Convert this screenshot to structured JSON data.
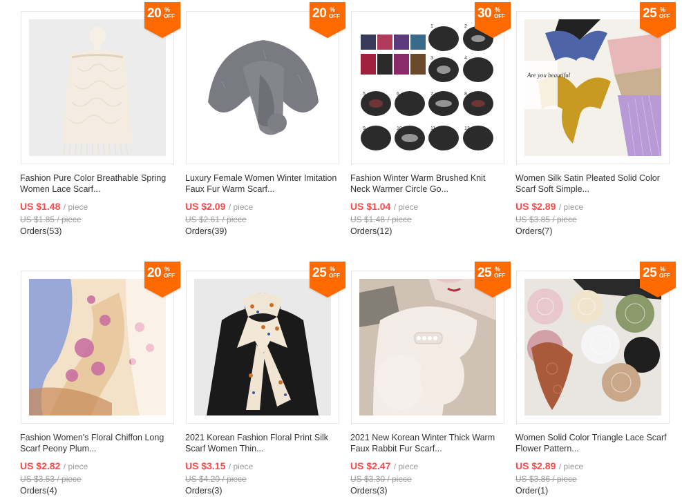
{
  "badge_color": "#ff6a00",
  "price_color": "#ff4747",
  "products": [
    {
      "discount": "20",
      "pct": "%",
      "off": "OFF",
      "title": "Fashion Pure Color Breathable Spring Women Lace Scarf...",
      "price": "US $1.48",
      "unit": "/ piece",
      "old_price": "US $1.85 / piece",
      "orders": "Orders(53)",
      "image": "cream-lace-scarf"
    },
    {
      "discount": "20",
      "pct": "%",
      "off": "OFF",
      "title": "Luxury Female Women Winter Imitation Faux Fur Warm Scarf...",
      "price": "US $2.09",
      "unit": "/ piece",
      "old_price": "US $2.61 / piece",
      "orders": "Orders(39)",
      "image": "gray-fur-scarf"
    },
    {
      "discount": "30",
      "pct": "%",
      "off": "OFF",
      "title": "Fashion Winter Warm Brushed Knit Neck Warmer Circle Go...",
      "price": "US $1.04",
      "unit": "/ piece",
      "old_price": "US $1.48 / piece",
      "orders": "Orders(12)",
      "image": "neck-warmers-grid",
      "grid_numbers": [
        "1",
        "2",
        "3",
        "4",
        "5",
        "6",
        "7",
        "8",
        "9",
        "10",
        "11",
        "12"
      ]
    },
    {
      "discount": "25",
      "pct": "%",
      "off": "OFF",
      "title": "Women Silk Satin Pleated Solid Color Scarf Soft Simple...",
      "price": "US $2.89",
      "unit": "/ piece",
      "old_price": "US $3.85 / piece",
      "orders": "Orders(7)",
      "image": "pleated-silk-scarves",
      "card_text": "Are you beautiful"
    },
    {
      "discount": "20",
      "pct": "%",
      "off": "OFF",
      "title": "Fashion Women's Floral Chiffon Long Scarf Peony Plum...",
      "price": "US $2.82",
      "unit": "/ piece",
      "old_price": "US $3.53 / piece",
      "orders": "Orders(4)",
      "image": "floral-chiffon-scarf"
    },
    {
      "discount": "25",
      "pct": "%",
      "off": "OFF",
      "title": "2021 Korean Fashion Floral Print Silk Scarf Women Thin...",
      "price": "US $3.15",
      "unit": "/ piece",
      "old_price": "US $4.20 / piece",
      "orders": "Orders(3)",
      "image": "silk-print-scarf"
    },
    {
      "discount": "25",
      "pct": "%",
      "off": "OFF",
      "title": "2021 New Korean Winter Thick Warm Faux Rabbit Fur Scarf...",
      "price": "US $2.47",
      "unit": "/ piece",
      "old_price": "US $3.30 / piece",
      "orders": "Orders(3)",
      "image": "white-fur-scarf"
    },
    {
      "discount": "25",
      "pct": "%",
      "off": "OFF",
      "title": "Women Solid Color Triangle Lace Scarf Flower Pattern...",
      "price": "US $2.89",
      "unit": "/ piece",
      "old_price": "US $3.86 / piece",
      "orders": "Order(1)",
      "image": "triangle-lace-scarves"
    }
  ]
}
